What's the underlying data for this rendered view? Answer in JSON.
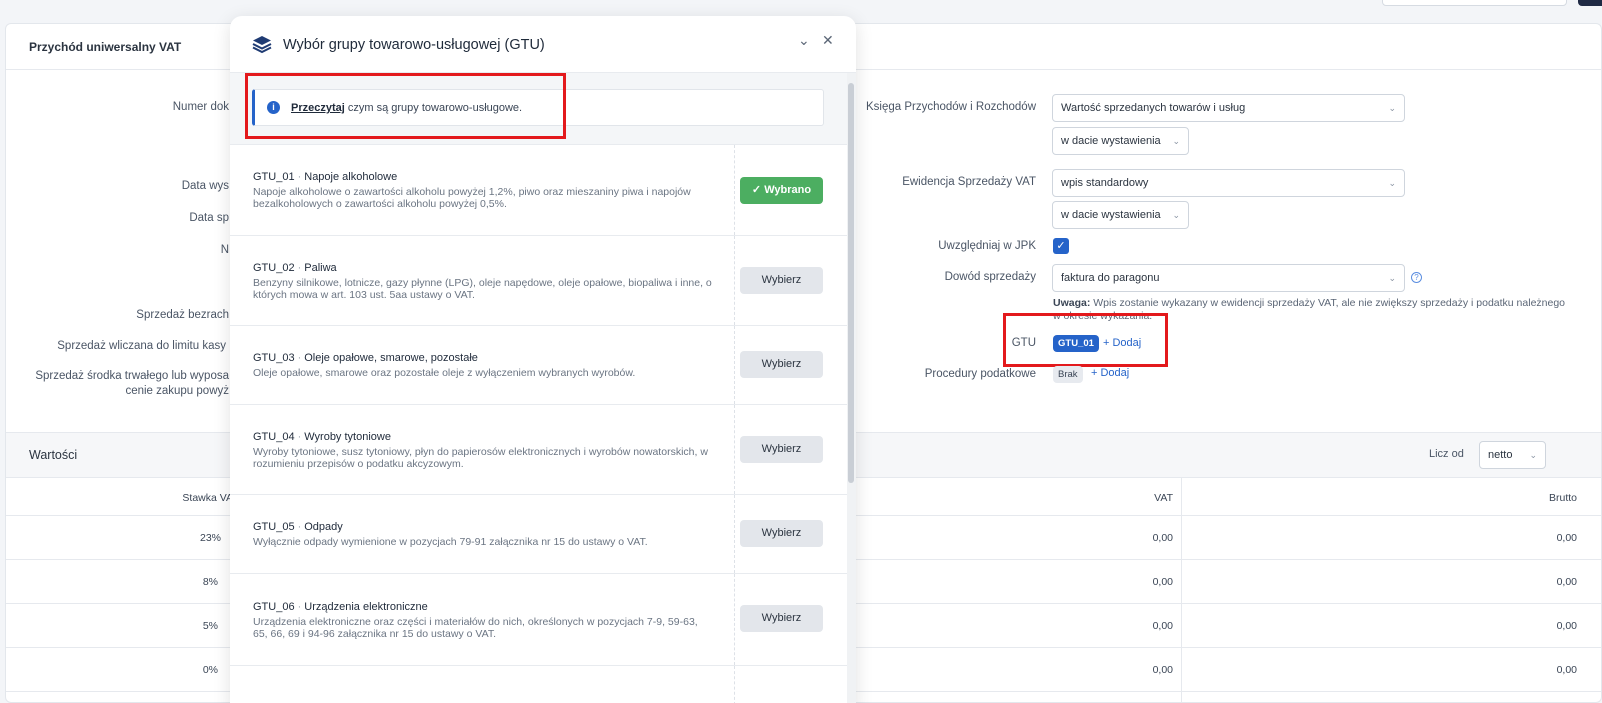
{
  "form": {
    "card_title": "Przychód uniwersalny VAT",
    "left_labels": {
      "numer": "Numer dok",
      "data_wys": "Data wys",
      "data_sp": "Data sp",
      "n": "N",
      "sprzedaz_bezrach": "Sprzedaż bezrach",
      "sprzedaz_limit": "Sprzedaż wliczana do limitu kasy",
      "sprzedaz_srodka_1": "Sprzedaż środka trwałego lub wyposa",
      "sprzedaz_srodka_2": "cenie zakupu powyż"
    },
    "kpir": {
      "label": "Księga Przychodów i Rozchodów",
      "value": "Wartość sprzedanych towarów i usług",
      "date_value": "w dacie wystawienia"
    },
    "ewidencja": {
      "label": "Ewidencja Sprzedaży VAT",
      "value": "wpis standardowy",
      "date_value": "w dacie wystawienia"
    },
    "jpk": {
      "label": "Uwzględniaj w JPK",
      "checked": true
    },
    "dowod": {
      "label": "Dowód sprzedaży",
      "value": "faktura do paragonu",
      "note_bold": "Uwaga:",
      "note_text": "Wpis zostanie wykazany w ewidencji sprzedaży VAT, ale nie zwiększy sprzedaży i podatku należnego",
      "note_text2": "w okresie wykazania."
    },
    "gtu": {
      "label": "GTU",
      "badge": "GTU_01",
      "add": "+ Dodaj"
    },
    "procedury": {
      "label": "Procedury podatkowe",
      "badge": "Brak",
      "add": "+ Dodaj"
    }
  },
  "values_section": {
    "title": "Wartości",
    "liczod_label": "Licz od",
    "liczod_value": "netto",
    "columns": {
      "stawka": "Stawka VA",
      "vat": "VAT",
      "brutto": "Brutto"
    },
    "rows": [
      {
        "rate": "23%",
        "vat": "0,00",
        "brutto": "0,00"
      },
      {
        "rate": "8%",
        "vat": "0,00",
        "brutto": "0,00"
      },
      {
        "rate": "5%",
        "vat": "0,00",
        "brutto": "0,00"
      },
      {
        "rate": "0%",
        "vat": "0,00",
        "brutto": "0,00"
      }
    ]
  },
  "modal": {
    "title": "Wybór grupy towarowo-usługowej (GTU)",
    "info_link": "Przeczytaj",
    "info_text": " czym są grupy towarowo-usługowe.",
    "items": [
      {
        "code": "GTU_01",
        "name": "Napoje alkoholowe",
        "desc": "Napoje alkoholowe o zawartości alkoholu powyżej 1,2%, piwo oraz mieszaniny piwa i napojów bezalkoholowych o zawartości alkoholu powyżej 0,5%.",
        "button": "Wybrano",
        "selected": true
      },
      {
        "code": "GTU_02",
        "name": "Paliwa",
        "desc": "Benzyny silnikowe, lotnicze, gazy płynne (LPG), oleje napędowe, oleje opałowe, biopaliwa i inne, o których mowa w art. 103 ust. 5aa ustawy o VAT.",
        "button": "Wybierz",
        "selected": false
      },
      {
        "code": "GTU_03",
        "name": "Oleje opałowe, smarowe, pozostałe",
        "desc": "Oleje opałowe, smarowe oraz pozostałe oleje z wyłączeniem wybranych wyrobów.",
        "button": "Wybierz",
        "selected": false
      },
      {
        "code": "GTU_04",
        "name": "Wyroby tytoniowe",
        "desc": "Wyroby tytoniowe, susz tytoniowy, płyn do papierosów elektronicznych i wyrobów nowatorskich, w rozumieniu przepisów o podatku akcyzowym.",
        "button": "Wybierz",
        "selected": false
      },
      {
        "code": "GTU_05",
        "name": "Odpady",
        "desc": "Wyłącznie odpady wymienione w pozycjach 79-91 załącznika nr 15 do ustawy o VAT.",
        "button": "Wybierz",
        "selected": false
      },
      {
        "code": "GTU_06",
        "name": "Urządzenia elektroniczne",
        "desc": "Urządzenia elektroniczne oraz części i materiałów do nich, określonych w pozycjach 7-9, 59-63, 65, 66, 69 i 94-96 załącznika nr 15 do ustawy o VAT.",
        "button": "Wybierz",
        "selected": false
      }
    ]
  },
  "colors": {
    "accent": "#2563c9",
    "success": "#4cae61",
    "highlight": "#e3191c"
  }
}
